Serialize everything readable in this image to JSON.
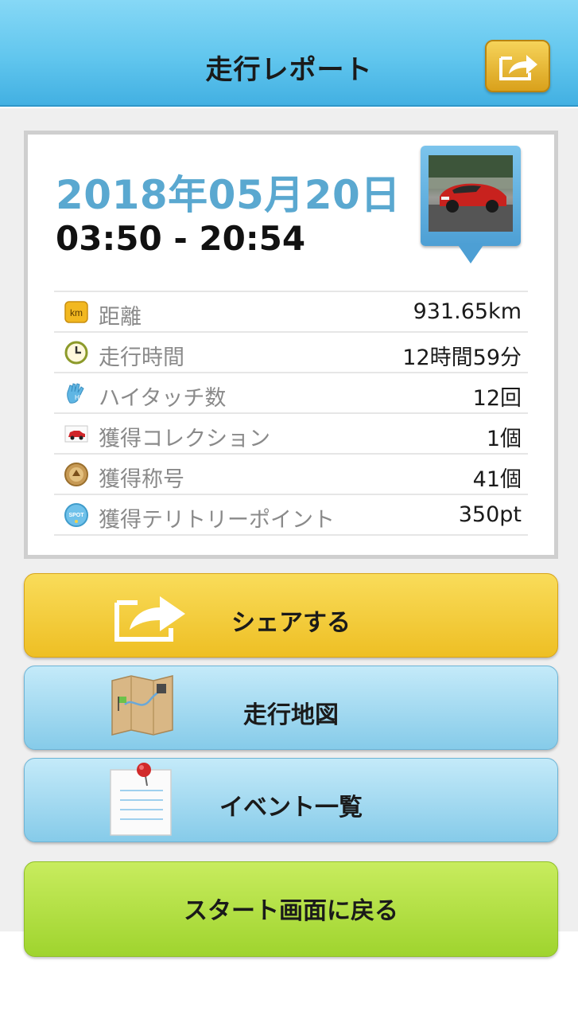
{
  "header": {
    "title": "走行レポート",
    "share_icon": "share-arrow-icon"
  },
  "report": {
    "date": "2018年05月20日",
    "time_range": "03:50 - 20:54",
    "thumbnail": "car-photo-thumbnail"
  },
  "stats": [
    {
      "icon": "km-icon",
      "label": "距離",
      "value": "931.65km"
    },
    {
      "icon": "clock-icon",
      "label": "走行時間",
      "value": "12時間59分"
    },
    {
      "icon": "high-five-icon",
      "label": "ハイタッチ数",
      "value": "12回"
    },
    {
      "icon": "car-icon",
      "label": "獲得コレクション",
      "value": "1個"
    },
    {
      "icon": "medal-icon",
      "label": "獲得称号",
      "value": "41個"
    },
    {
      "icon": "spot-icon",
      "label": "獲得テリトリーポイント",
      "value": "350pt"
    }
  ],
  "buttons": {
    "share": "シェアする",
    "map": "走行地図",
    "events": "イベント一覧",
    "start": "スタート画面に戻る"
  },
  "colors": {
    "header": "#61c6ee",
    "date": "#5aa8d0",
    "share_button": "#f3cb3a",
    "map_button": "#9fd6ee",
    "start_button": "#b4e044"
  }
}
